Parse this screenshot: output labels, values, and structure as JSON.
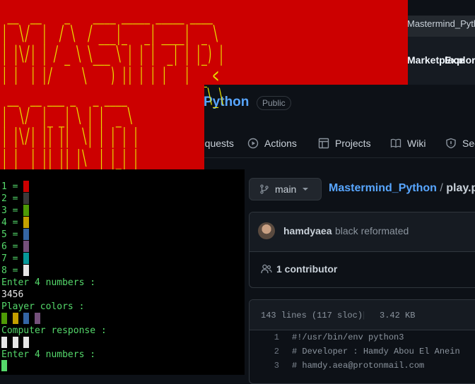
{
  "browser": {
    "tab_title": "Mastermind_Python",
    "nav": [
      "Marketplace",
      "Explore"
    ]
  },
  "repo": {
    "name": "Python",
    "visibility": "Public",
    "tabs": [
      "Pull requests",
      "Actions",
      "Projects",
      "Wiki",
      "Security"
    ],
    "branch": "main",
    "breadcrumb_repo": "Mastermind_Python",
    "breadcrumb_sep": "/",
    "breadcrumb_file": "play.py",
    "commit_author": "hamdyaea",
    "commit_message": "black reformated",
    "contributors": "1 contributor",
    "file_lines": "143 lines (117 sloc)",
    "file_size": "3.42 KB",
    "code": [
      {
        "n": "1",
        "t": "#!/usr/bin/env python3"
      },
      {
        "n": "2",
        "t": "# Developer : Hamdy Abou El Anein"
      },
      {
        "n": "3",
        "t": "# hamdy.aea@protonmail.com"
      }
    ]
  },
  "banner": {
    "word1": "MASTER",
    "word2": "MIND",
    "colors": {
      "background": "#cc0000",
      "text": "#e8e000"
    }
  },
  "terminal": {
    "legend": [
      {
        "label": "1 = ",
        "color": "#cc0000"
      },
      {
        "label": "2 = ",
        "color": "#3a3a3a"
      },
      {
        "label": "3 = ",
        "color": "#4e9a06"
      },
      {
        "label": "4 = ",
        "color": "#c4a000"
      },
      {
        "label": "5 = ",
        "color": "#3465a4"
      },
      {
        "label": "6 = ",
        "color": "#75507b"
      },
      {
        "label": "7 = ",
        "color": "#06989a"
      },
      {
        "label": "8 = ",
        "color": "#e6e6e6"
      }
    ],
    "prompt_numbers": "Enter 4 numbers :",
    "user_input": "3456",
    "player_colors_label": "Player colors :",
    "player_pegs": [
      "#4e9a06",
      "#c4a000",
      "#3465a4",
      "#75507b"
    ],
    "computer_response_label": "Computer response :",
    "response_pegs": [
      "#e6e6e6",
      "#e6e6e6",
      "#e6e6e6"
    ],
    "prompt_numbers_2": "Enter 4 numbers :",
    "text_color": "#55d96b"
  }
}
